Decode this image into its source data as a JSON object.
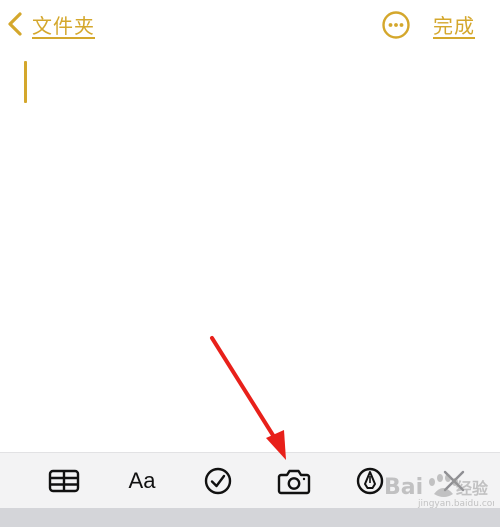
{
  "nav": {
    "back_label": "文件夹",
    "done_label": "完成"
  },
  "icons": {
    "back": "chevron-left-icon",
    "more": "ellipsis-circle-icon",
    "table": "table-icon",
    "format": "text-format-icon",
    "checklist": "checkmark-circle-icon",
    "camera": "camera-icon",
    "markup": "pen-tip-circle-icon",
    "close": "close-icon"
  },
  "toolbar": {
    "format_label": "Aa"
  },
  "colors": {
    "accent": "#d4a72c",
    "annotation_arrow": "#e8201a",
    "toolbar_bg": "#f3f3f4"
  }
}
